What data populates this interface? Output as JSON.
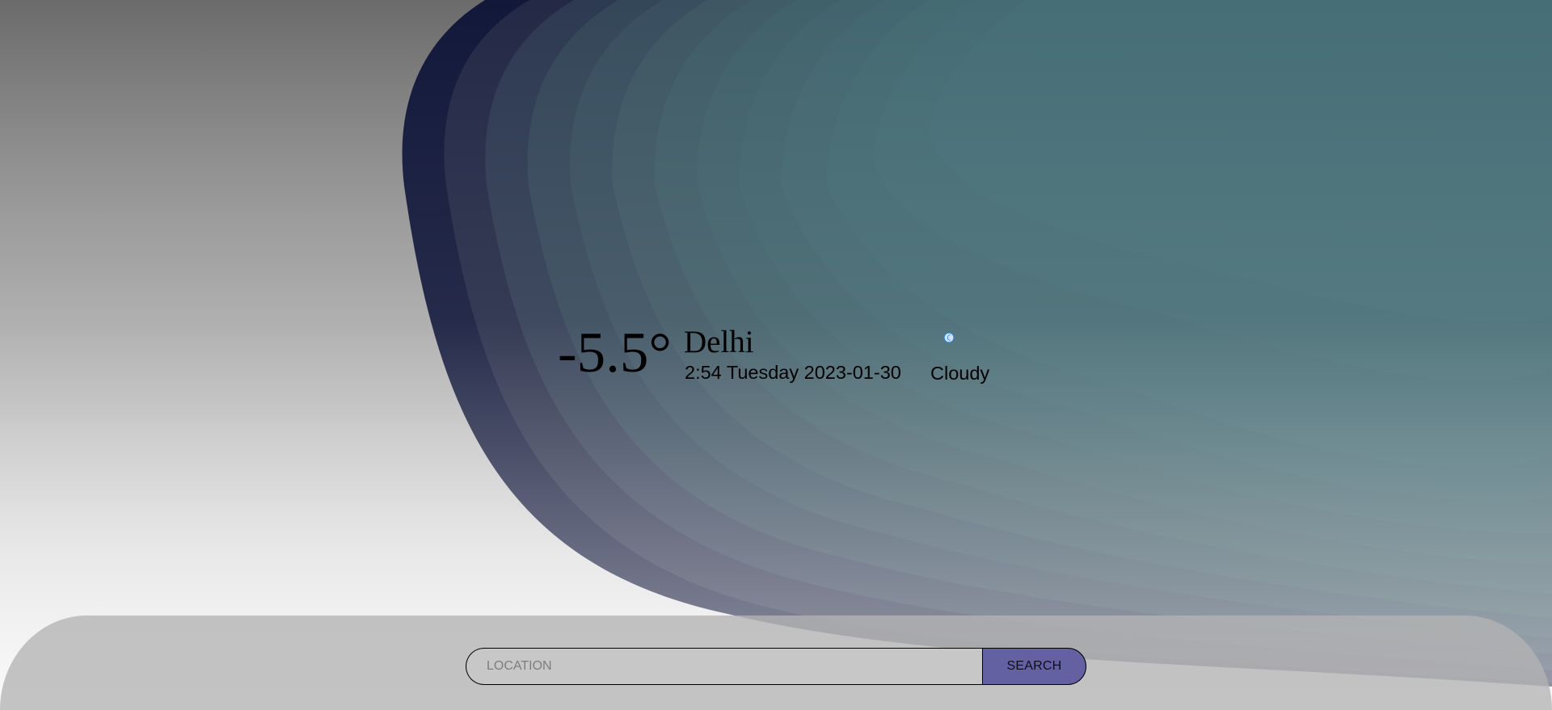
{
  "weather": {
    "temperature": "-5.5°",
    "city": "Delhi",
    "datetime": "2:54 Tuesday 2023-01-30",
    "condition": "Cloudy",
    "condition_icon": "cloudy-night-icon"
  },
  "search": {
    "placeholder": "LOCATION",
    "value": "",
    "button_label": "SEARCH"
  },
  "colors": {
    "accent": "#6461a2",
    "wave_dark": "#0b1334",
    "wave_teal": "#3d616c"
  }
}
